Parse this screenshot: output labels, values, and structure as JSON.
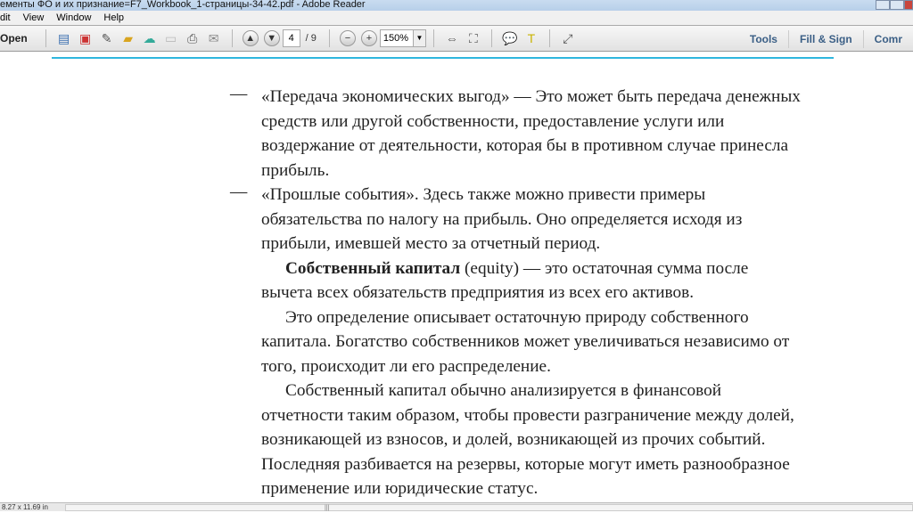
{
  "window": {
    "title": "ементы ФО и их признание=F7_Workbook_1-страницы-34-42.pdf - Adobe Reader"
  },
  "menu": [
    "dit",
    "View",
    "Window",
    "Help"
  ],
  "toolbar": {
    "open": "Open",
    "page_current": "4",
    "page_total": "/ 9",
    "zoom": "150%",
    "tools": "Tools",
    "fill_sign": "Fill & Sign",
    "comment": "Comr"
  },
  "document": {
    "lines": [
      "«Передача экономических выгод»  — Это может быть передача денежных",
      "средств или другой собственности, предоставление услуги или",
      "воздержание от деятельности, которая бы в противном случае принесла",
      "прибыль.",
      "«Прошлые события». Здесь также можно привести примеры",
      "обязательства по налогу на прибыль. Оно определяется исходя из",
      "прибыли, имевшей место за отчетный период.",
      " (equity) — это остаточная сумма после",
      "вычета всех обязательств предприятия из всех его активов.",
      "Это определение описывает остаточную природу собственного",
      "капитала. Богатство собственников может увеличиваться независимо от",
      "того, происходит ли его распределение.",
      "Собственный капитал обычно анализируется в финансовой",
      "отчетности таким образом, чтобы провести разграничение между долей,",
      "возникающей из взносов, и долей, возникающей из прочих событий.",
      "Последняя разбивается на резервы, которые могут иметь разнообразное",
      "применение или юридические статус."
    ],
    "bold_term": "Собственный капитал",
    "dash": "—"
  },
  "status": {
    "dims": "8.27 x 11.69 in"
  }
}
